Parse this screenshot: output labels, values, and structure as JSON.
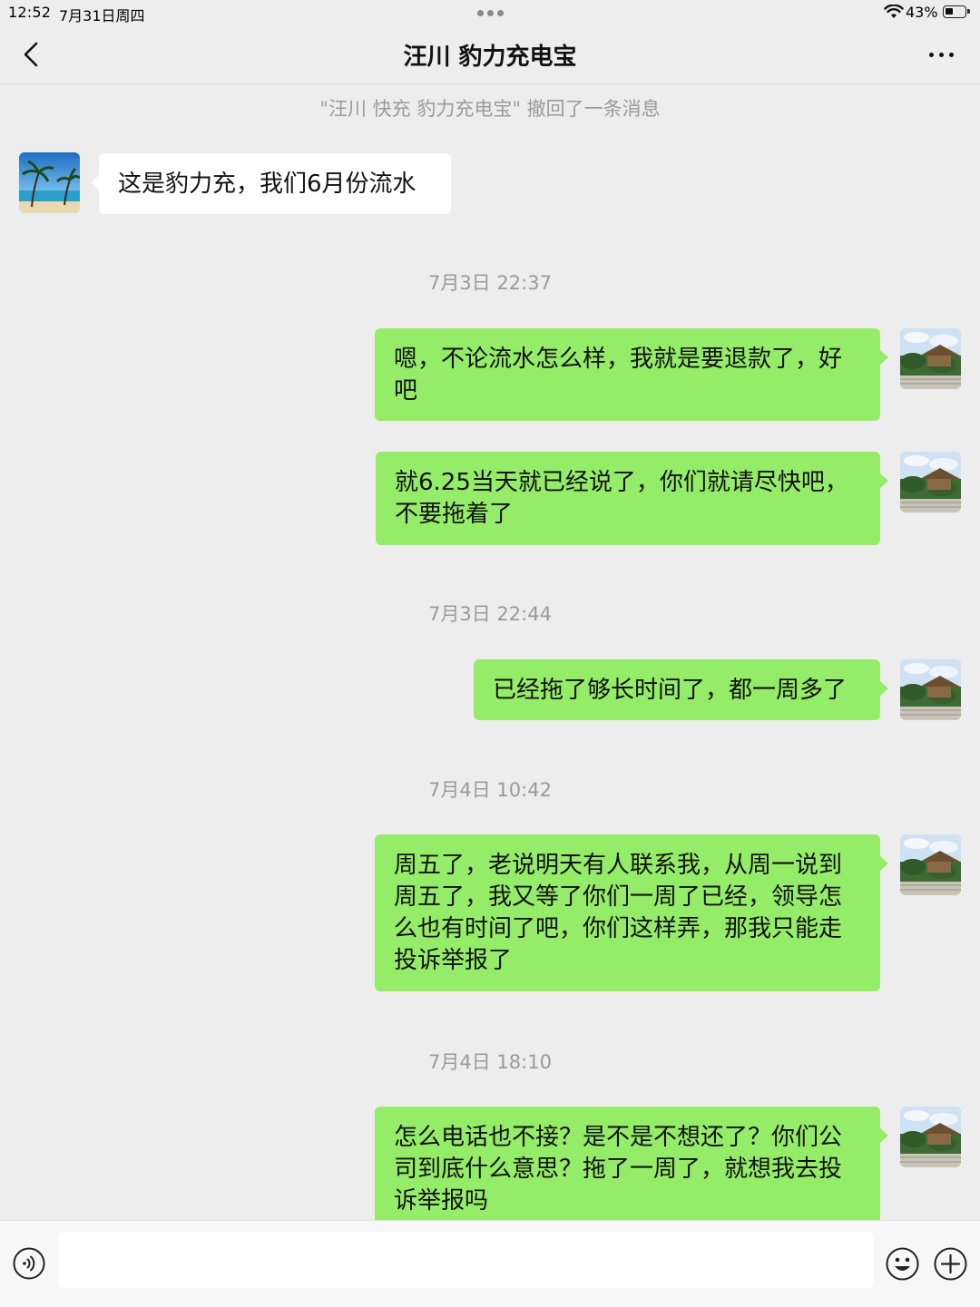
{
  "status_bar": {
    "time": "12:52",
    "date": "7月31日周四",
    "battery_percent": "43%",
    "battery_level": 0.43
  },
  "header": {
    "title": "汪川 豹力充电宝"
  },
  "system_notice": "\"汪川 快充 豹力充电宝\" 撤回了一条消息",
  "messages": [
    {
      "side": "received",
      "text": "这是豹力充，我们6月份流水"
    },
    {
      "side": "timestamp",
      "text": "7月3日 22:37"
    },
    {
      "side": "sent",
      "text": "嗯，不论流水怎么样，我就是要退款了，好吧"
    },
    {
      "side": "sent",
      "text": "就6.25当天就已经说了，你们就请尽快吧，不要拖着了"
    },
    {
      "side": "timestamp",
      "text": "7月3日 22:44"
    },
    {
      "side": "sent",
      "text": "已经拖了够长时间了，都一周多了"
    },
    {
      "side": "timestamp",
      "text": "7月4日 10:42"
    },
    {
      "side": "sent",
      "text": "周五了，老说明天有人联系我，从周一说到周五了，我又等了你们一周了已经，领导怎么也有时间了吧，你们这样弄，那我只能走投诉举报了"
    },
    {
      "side": "timestamp",
      "text": "7月4日 18:10"
    },
    {
      "side": "sent",
      "text": "怎么电话也不接？是不是不想还了？你们公司到底什么意思？拖了一周了，就想我去投诉举报吗"
    }
  ],
  "input_bar": {
    "value": "",
    "placeholder": ""
  },
  "icons": {
    "back": "chevron-left-icon",
    "more": "more-dots-icon",
    "voice": "voice-icon",
    "emoji": "emoji-icon",
    "plus": "plus-icon",
    "wifi": "wifi-icon",
    "battery": "battery-icon"
  },
  "colors": {
    "background": "#ededed",
    "sent_bubble": "#95ec69",
    "received_bubble": "#ffffff",
    "timestamp_text": "#9a9a9a"
  }
}
